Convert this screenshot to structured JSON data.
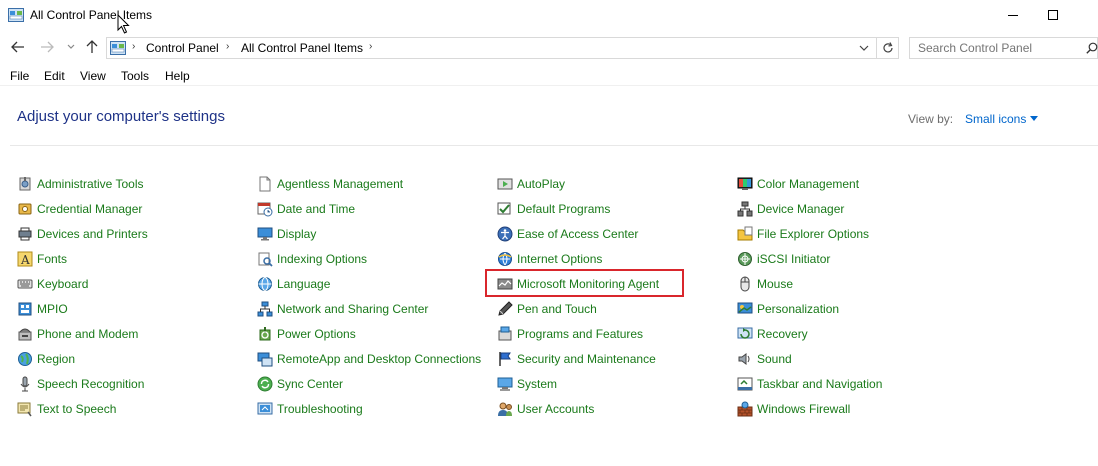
{
  "window": {
    "title": "All Control Panel Items"
  },
  "address": {
    "crumbs": [
      "Control Panel",
      "All Control Panel Items"
    ],
    "search_placeholder": "Search Control Panel"
  },
  "menu": [
    "File",
    "Edit",
    "View",
    "Tools",
    "Help"
  ],
  "content": {
    "heading": "Adjust your computer's settings",
    "view_by_label": "View by:",
    "view_by_value": "Small icons"
  },
  "highlighted_item": "Microsoft Monitoring Agent",
  "columns": [
    [
      {
        "label": "Administrative Tools",
        "icon": "administrative-tools-icon"
      },
      {
        "label": "Credential Manager",
        "icon": "credential-manager-icon"
      },
      {
        "label": "Devices and Printers",
        "icon": "devices-printers-icon"
      },
      {
        "label": "Fonts",
        "icon": "fonts-icon"
      },
      {
        "label": "Keyboard",
        "icon": "keyboard-icon"
      },
      {
        "label": "MPIO",
        "icon": "mpio-icon"
      },
      {
        "label": "Phone and Modem",
        "icon": "phone-modem-icon"
      },
      {
        "label": "Region",
        "icon": "region-icon"
      },
      {
        "label": "Speech Recognition",
        "icon": "microphone-icon"
      },
      {
        "label": "Text to Speech",
        "icon": "text-to-speech-icon"
      }
    ],
    [
      {
        "label": "Agentless Management",
        "icon": "document-icon"
      },
      {
        "label": "Date and Time",
        "icon": "calendar-clock-icon"
      },
      {
        "label": "Display",
        "icon": "monitor-icon"
      },
      {
        "label": "Indexing Options",
        "icon": "indexing-icon"
      },
      {
        "label": "Language",
        "icon": "language-globe-icon"
      },
      {
        "label": "Network and Sharing Center",
        "icon": "network-icon"
      },
      {
        "label": "Power Options",
        "icon": "power-icon"
      },
      {
        "label": "RemoteApp and Desktop Connections",
        "icon": "remoteapp-icon"
      },
      {
        "label": "Sync Center",
        "icon": "sync-icon"
      },
      {
        "label": "Troubleshooting",
        "icon": "troubleshooting-icon"
      }
    ],
    [
      {
        "label": "AutoPlay",
        "icon": "autoplay-icon"
      },
      {
        "label": "Default Programs",
        "icon": "default-programs-icon"
      },
      {
        "label": "Ease of Access Center",
        "icon": "ease-of-access-icon"
      },
      {
        "label": "Internet Options",
        "icon": "internet-options-icon"
      },
      {
        "label": "Microsoft Monitoring Agent",
        "icon": "monitoring-agent-icon"
      },
      {
        "label": "Pen and Touch",
        "icon": "pen-icon"
      },
      {
        "label": "Programs and Features",
        "icon": "programs-features-icon"
      },
      {
        "label": "Security and Maintenance",
        "icon": "flag-icon"
      },
      {
        "label": "System",
        "icon": "system-icon"
      },
      {
        "label": "User Accounts",
        "icon": "user-accounts-icon"
      }
    ],
    [
      {
        "label": "Color Management",
        "icon": "color-management-icon"
      },
      {
        "label": "Device Manager",
        "icon": "device-manager-icon"
      },
      {
        "label": "File Explorer Options",
        "icon": "folder-options-icon"
      },
      {
        "label": "iSCSI Initiator",
        "icon": "iscsi-icon"
      },
      {
        "label": "Mouse",
        "icon": "mouse-icon"
      },
      {
        "label": "Personalization",
        "icon": "personalization-icon"
      },
      {
        "label": "Recovery",
        "icon": "recovery-icon"
      },
      {
        "label": "Sound",
        "icon": "speaker-icon"
      },
      {
        "label": "Taskbar and Navigation",
        "icon": "taskbar-icon"
      },
      {
        "label": "Windows Firewall",
        "icon": "firewall-icon"
      }
    ]
  ]
}
